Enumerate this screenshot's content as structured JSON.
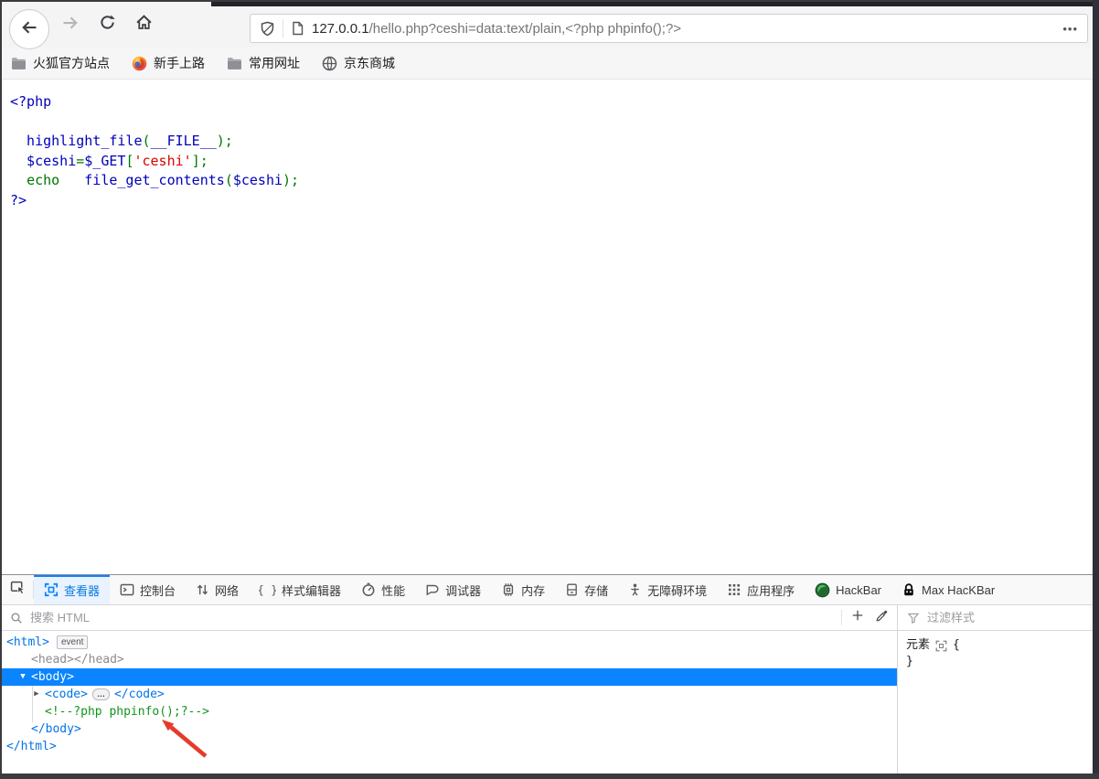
{
  "colors": {
    "accent": "#0a84ff",
    "selected_row": "#0a84ff",
    "tag_blue": "#0074e8",
    "comment_green": "#11951c",
    "arrow_red": "#e53b2c",
    "php_blue": "#0000BB",
    "php_green": "#007700",
    "php_red": "#DD0000"
  },
  "chrome": {
    "url": {
      "domain": "127.0.0.1",
      "path": "/hello.php?ceshi=data:text/plain,<?php phpinfo();?>"
    },
    "page_actions": "•••",
    "bookmarks": [
      {
        "key": "firefox-official",
        "label": "火狐官方站点",
        "icon": "folder-icon"
      },
      {
        "key": "getting-started",
        "label": "新手上路",
        "icon": "firefox-icon"
      },
      {
        "key": "common-sites",
        "label": "常用网址",
        "icon": "folder-icon"
      },
      {
        "key": "jd-mall",
        "label": "京东商城",
        "icon": "globe-icon"
      }
    ]
  },
  "page": {
    "code_lines": [
      [
        {
          "t": "<?php",
          "c": "pb"
        }
      ],
      [],
      [
        {
          "t": "  highlight_file",
          "c": "pb"
        },
        {
          "t": "(",
          "c": "pg"
        },
        {
          "t": "__FILE__",
          "c": "pb"
        },
        {
          "t": ");",
          "c": "pg"
        }
      ],
      [
        {
          "t": "  $ceshi",
          "c": "pb"
        },
        {
          "t": "=",
          "c": "pg"
        },
        {
          "t": "$_GET",
          "c": "pb"
        },
        {
          "t": "[",
          "c": "pg"
        },
        {
          "t": "'ceshi'",
          "c": "pr"
        },
        {
          "t": "];",
          "c": "pg"
        }
      ],
      [
        {
          "t": "  ",
          "c": "pb"
        },
        {
          "t": "echo",
          "c": "pg"
        },
        {
          "t": "   ",
          "c": "pg"
        },
        {
          "t": "file_get_contents",
          "c": "pb"
        },
        {
          "t": "(",
          "c": "pg"
        },
        {
          "t": "$ceshi",
          "c": "pb"
        },
        {
          "t": ");",
          "c": "pg"
        }
      ],
      [
        {
          "t": "?>",
          "c": "pb"
        }
      ]
    ]
  },
  "devtools": {
    "tabs": [
      {
        "key": "inspector",
        "label": "查看器",
        "icon": "inspector-icon",
        "active": true
      },
      {
        "key": "console",
        "label": "控制台",
        "icon": "console-icon",
        "active": false
      },
      {
        "key": "network",
        "label": "网络",
        "icon": "network-icon",
        "active": false
      },
      {
        "key": "style-editor",
        "label": "样式编辑器",
        "icon": "braces-icon",
        "active": false
      },
      {
        "key": "performance",
        "label": "性能",
        "icon": "performance-icon",
        "active": false
      },
      {
        "key": "debugger",
        "label": "调试器",
        "icon": "debugger-icon",
        "active": false
      },
      {
        "key": "memory",
        "label": "内存",
        "icon": "memory-icon",
        "active": false
      },
      {
        "key": "storage",
        "label": "存储",
        "icon": "storage-icon",
        "active": false
      },
      {
        "key": "accessibility",
        "label": "无障碍环境",
        "icon": "accessibility-icon",
        "active": false
      },
      {
        "key": "application",
        "label": "应用程序",
        "icon": "application-icon",
        "active": false
      },
      {
        "key": "hackbar",
        "label": "HackBar",
        "icon": "hackbar-icon",
        "active": false
      },
      {
        "key": "max-hackbar",
        "label": "Max HacKBar",
        "icon": "lock-icon",
        "active": false
      }
    ],
    "search_placeholder": "搜索 HTML",
    "filter_placeholder": "过滤样式",
    "tree": [
      {
        "key": "html-open",
        "indent": 0,
        "parts": [
          {
            "t": "<html>",
            "c": "tag"
          }
        ],
        "badge": "event"
      },
      {
        "key": "head",
        "indent": 1,
        "parts": [
          {
            "t": "<head></head>",
            "c": "dim"
          }
        ]
      },
      {
        "key": "body-open",
        "indent": 1,
        "arrow": "down",
        "selected": true,
        "parts": [
          {
            "t": "<body>",
            "c": "tag"
          }
        ]
      },
      {
        "key": "code",
        "indent": 2,
        "arrow": "right",
        "parts": [
          {
            "t": "<code>",
            "c": "tag"
          },
          {
            "t": "…",
            "c": "pill"
          },
          {
            "t": "</code>",
            "c": "tag"
          }
        ]
      },
      {
        "key": "comment",
        "indent": 2,
        "parts": [
          {
            "t": "<!--?php phpinfo();?-->",
            "c": "comment"
          }
        ]
      },
      {
        "key": "body-close",
        "indent": 1,
        "parts": [
          {
            "t": "</body>",
            "c": "tag"
          }
        ]
      },
      {
        "key": "html-close",
        "indent": 0,
        "parts": [
          {
            "t": "</html>",
            "c": "tag"
          }
        ]
      }
    ],
    "rules": {
      "selector": "元素",
      "brace_open": "{",
      "brace_close": "}"
    }
  }
}
